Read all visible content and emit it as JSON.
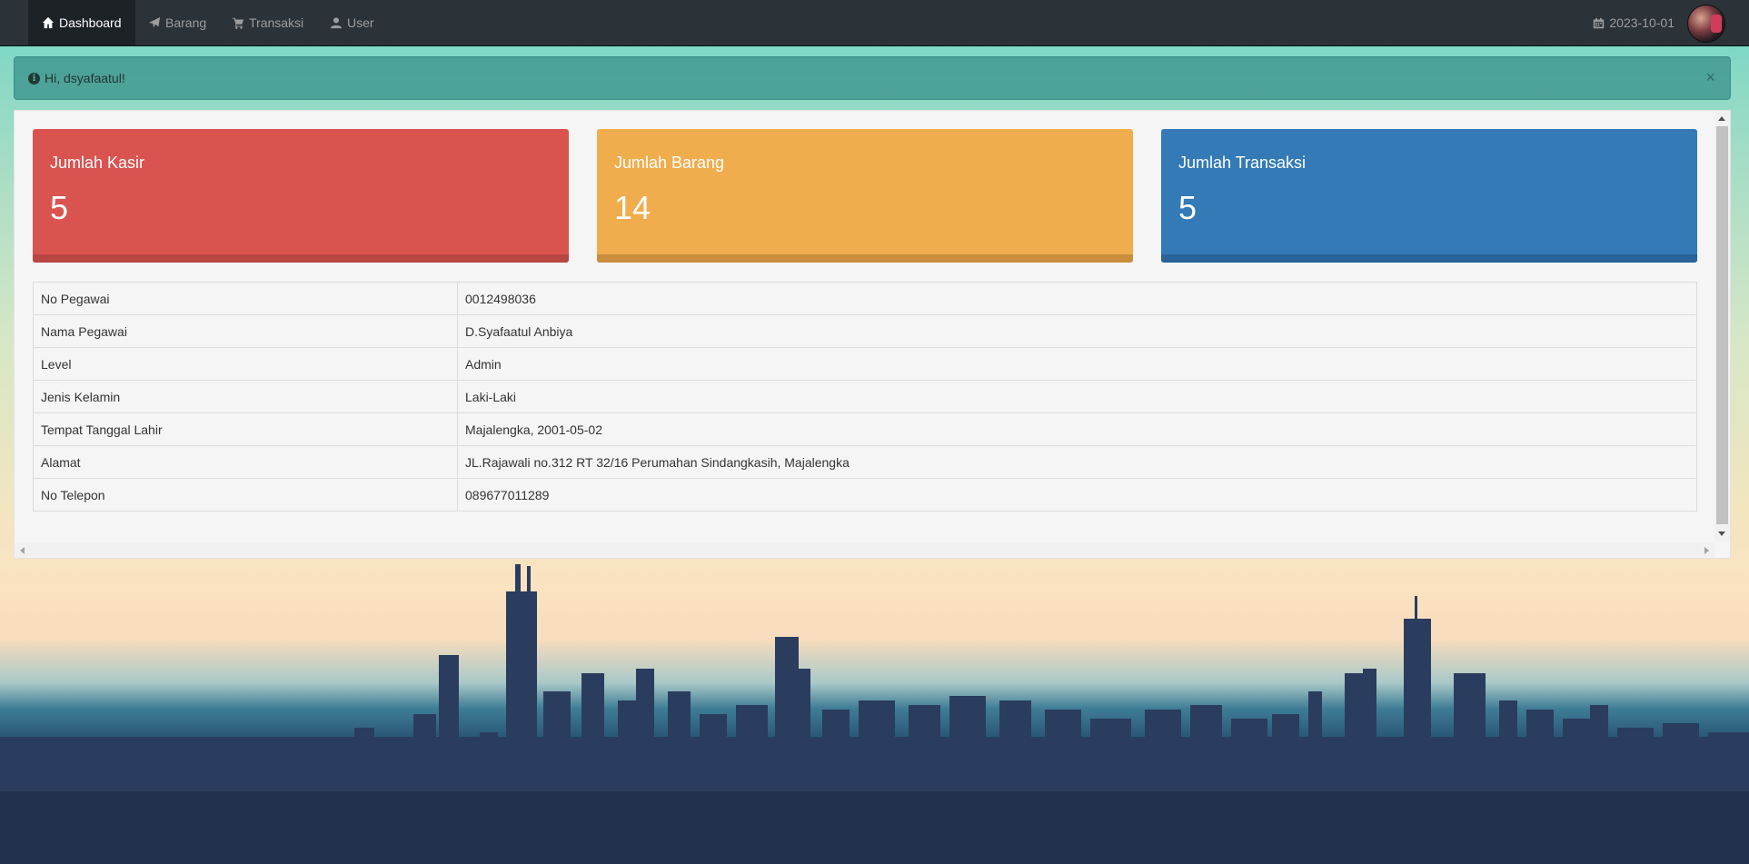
{
  "nav": {
    "items": [
      {
        "label": "Dashboard",
        "icon": "home-icon"
      },
      {
        "label": "Barang",
        "icon": "send-icon"
      },
      {
        "label": "Transaksi",
        "icon": "cart-icon"
      },
      {
        "label": "User",
        "icon": "user-icon"
      }
    ],
    "date": "2023-10-01"
  },
  "alert": {
    "message": "Hi, dsyafaatul!",
    "close": "×"
  },
  "stats": [
    {
      "label": "Jumlah Kasir",
      "value": "5",
      "color": "#d9534f"
    },
    {
      "label": "Jumlah Barang",
      "value": "14",
      "color": "#f0ad4e"
    },
    {
      "label": "Jumlah Transaksi",
      "value": "5",
      "color": "#337ab7"
    }
  ],
  "profile": {
    "rows": [
      {
        "key": "No Pegawai",
        "value": "0012498036"
      },
      {
        "key": "Nama Pegawai",
        "value": "D.Syafaatul Anbiya"
      },
      {
        "key": "Level",
        "value": "Admin"
      },
      {
        "key": "Jenis Kelamin",
        "value": "Laki-Laki"
      },
      {
        "key": "Tempat Tanggal Lahir",
        "value": "Majalengka, 2001-05-02"
      },
      {
        "key": "Alamat",
        "value": "JL.Rajawali no.312 RT 32/16 Perumahan Sindangkasih, Majalengka"
      },
      {
        "key": "No Telepon",
        "value": "089677011289"
      }
    ]
  }
}
